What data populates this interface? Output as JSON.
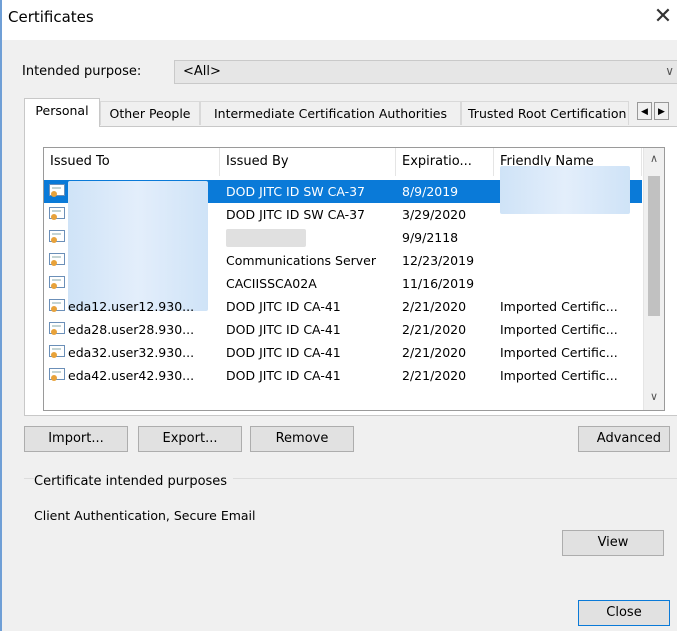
{
  "window": {
    "title": "Certificates",
    "close_glyph": "✕"
  },
  "purpose": {
    "label": "Intended purpose:",
    "value": "<All>",
    "arrow": "∨"
  },
  "tabs": [
    {
      "label": "Personal"
    },
    {
      "label": "Other People"
    },
    {
      "label": "Intermediate Certification Authorities"
    },
    {
      "label": "Trusted Root Certification"
    }
  ],
  "tab_scroll": {
    "left": "◀",
    "right": "▶"
  },
  "columns": [
    "Issued To",
    "Issued By",
    "Expiratio...",
    "Friendly Name"
  ],
  "rows": [
    {
      "issued_to": "",
      "issued_by": "DOD JITC ID SW CA-37",
      "expiration": "8/9/2019",
      "friendly": ""
    },
    {
      "issued_to": "",
      "issued_by": "DOD JITC ID SW CA-37",
      "expiration": "3/29/2020",
      "friendly": ""
    },
    {
      "issued_to": "",
      "issued_by": "",
      "expiration": "9/9/2118",
      "friendly": ""
    },
    {
      "issued_to": "",
      "issued_by": "Communications Server",
      "expiration": "12/23/2019",
      "friendly": ""
    },
    {
      "issued_to": "",
      "issued_by": "CACIISSCA02A",
      "expiration": "11/16/2019",
      "friendly": ""
    },
    {
      "issued_to": "eda12.user12.930...",
      "issued_by": "DOD JITC ID CA-41",
      "expiration": "2/21/2020",
      "friendly": "Imported Certific..."
    },
    {
      "issued_to": "eda28.user28.930...",
      "issued_by": "DOD JITC ID CA-41",
      "expiration": "2/21/2020",
      "friendly": "Imported Certific..."
    },
    {
      "issued_to": "eda32.user32.930...",
      "issued_by": "DOD JITC ID CA-41",
      "expiration": "2/21/2020",
      "friendly": "Imported Certific..."
    },
    {
      "issued_to": "eda42.user42.930...",
      "issued_by": "DOD JITC ID CA-41",
      "expiration": "2/21/2020",
      "friendly": "Imported Certific..."
    }
  ],
  "scroll": {
    "up": "∧",
    "down": "∨"
  },
  "buttons": {
    "import": "Import...",
    "export": "Export...",
    "remove": "Remove",
    "advanced": "Advanced",
    "view": "View",
    "close": "Close"
  },
  "purposes_group": {
    "title": "Certificate intended purposes",
    "text": "Client Authentication, Secure Email"
  },
  "colors": {
    "selection": "#0a7ad8",
    "accent_border": "#6f9fd6"
  }
}
